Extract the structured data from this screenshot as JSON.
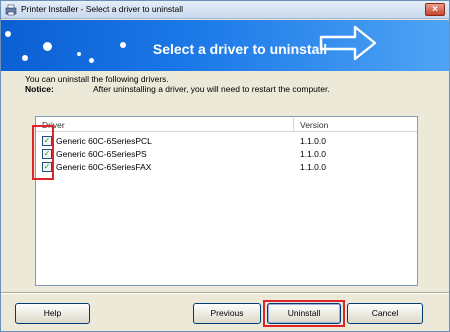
{
  "window": {
    "title": "Printer Installer - Select a driver to uninstall",
    "close_label": "×"
  },
  "banner": {
    "title": "Select a driver to uninstall"
  },
  "intro": "You can uninstall the following drivers.",
  "notice": {
    "label": "Notice:",
    "text": "After uninstalling a driver, you will need to restart the computer."
  },
  "list": {
    "columns": {
      "driver": "Driver",
      "version": "Version"
    },
    "rows": [
      {
        "name": "Generic 60C-6SeriesPCL",
        "version": "1.1.0.0",
        "checked": true
      },
      {
        "name": "Generic 60C-6SeriesPS",
        "version": "1.1.0.0",
        "checked": true
      },
      {
        "name": "Generic 60C-6SeriesFAX",
        "version": "1.1.0.0",
        "checked": true
      }
    ]
  },
  "buttons": {
    "help": "Help",
    "previous": "Previous",
    "uninstall": "Uninstall",
    "cancel": "Cancel"
  },
  "colors": {
    "banner": "#1d7ae8",
    "highlight": "#e0242b",
    "dialog": "#ece9d8"
  }
}
